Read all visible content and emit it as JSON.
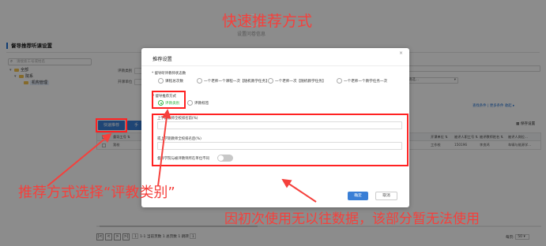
{
  "page": {
    "title": "督导推荐听课设置",
    "search_placeholder": "请搜索工号或姓名",
    "tree": [
      {
        "label": "全部"
      },
      {
        "label": "院系"
      },
      {
        "label": "机构管理"
      }
    ],
    "filters": {
      "label1": "评教类别",
      "value1": "请选",
      "label2": "开课单位",
      "value2": "请选",
      "right_select": "请选..."
    },
    "right_links": "查找条件 | 更多条件 收起 ▸",
    "toolbar": {
      "quick_recommend": "快速推荐",
      "btn2_label": "手"
    },
    "save_settings": "保存设置",
    "table": {
      "headers": [
        "督导工号 ⇅",
        "开课单位 ⇅",
        "被评人职工号 ⇅",
        "被评教师姓名 ⇅",
        "被评人岗位..."
      ],
      "row": {
        "col1": "我校",
        "col2": "工作校",
        "col3": "150196",
        "col4": "李良鸿",
        "col5": "车辆与能源学..."
      }
    },
    "pager": {
      "first": "|<",
      "prev": "<",
      "next": ">",
      "last": ">|",
      "page_value": "1",
      "info": "1-1 当前页数 1  总页数 1  跳转",
      "jump_value": "1",
      "page_size_label": "每页:",
      "page_size_value": "50"
    },
    "background_dialog_title": "设置问卷信息"
  },
  "modal": {
    "title": "推荐设置",
    "close": "×",
    "section1_label": "* 督导听评教师状态数",
    "section1_options": [
      "课程总次数",
      "一个老师一个课程一次【随机教学任务】",
      "一个老师一次【随机教学任务】",
      "一个老师一个教学任务一次"
    ],
    "section2_label": "* 督导推荐方式",
    "section2_options": [
      "评教类别",
      "评教标签"
    ],
    "field1_label": "上学期教师全校排名前(%)",
    "field2_label": "或上学期教师全校排名后(%)",
    "toggle_label": "督导学院与被评教师所在单位不同",
    "ok_label": "确定",
    "cancel_label": "取消"
  },
  "annotations": {
    "title": "快速推荐方式",
    "left": "推荐方式选择“评教类别”",
    "bottom": "因初次使用无以往数据，该部分暂无法使用"
  },
  "colors": {
    "annotation": "#f5403c",
    "primary": "#3a7fd6",
    "radio_selected": "#3bb54a"
  }
}
